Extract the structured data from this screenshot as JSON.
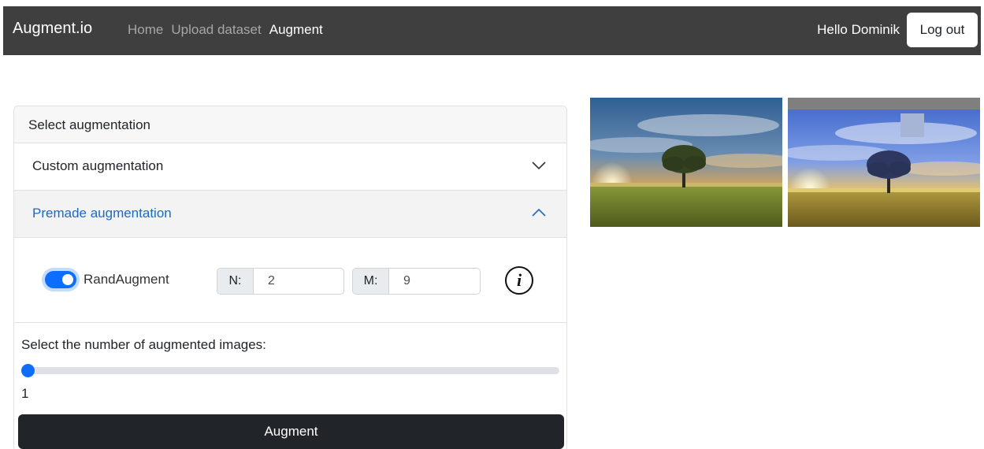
{
  "navbar": {
    "brand": "Augment.io",
    "links": [
      {
        "label": "Home",
        "active": false
      },
      {
        "label": "Upload dataset",
        "active": false
      },
      {
        "label": "Augment",
        "active": true
      }
    ],
    "greeting": "Hello Dominik",
    "logout_label": "Log out"
  },
  "card": {
    "header": "Select augmentation",
    "accordion": [
      {
        "label": "Custom augmentation",
        "expanded": false
      },
      {
        "label": "Premade augmentation",
        "expanded": true
      }
    ],
    "randaugment": {
      "label": "RandAugment",
      "enabled": true,
      "n_label": "N:",
      "n_value": "2",
      "m_label": "M:",
      "m_value": "9"
    },
    "count_label": "Select the number of augmented images:",
    "count_value": "1",
    "augment_label": "Augment"
  },
  "colors": {
    "navbar_bg": "#3f3f3f",
    "accent": "#0d6efd",
    "accordion_active_text": "#1d68c7",
    "button_dark": "#212529"
  },
  "icons": {
    "expand": "chevron-down-icon",
    "collapse": "chevron-up-icon",
    "info": "info-icon"
  },
  "images": [
    {
      "name": "original-image"
    },
    {
      "name": "augmented-image"
    }
  ]
}
